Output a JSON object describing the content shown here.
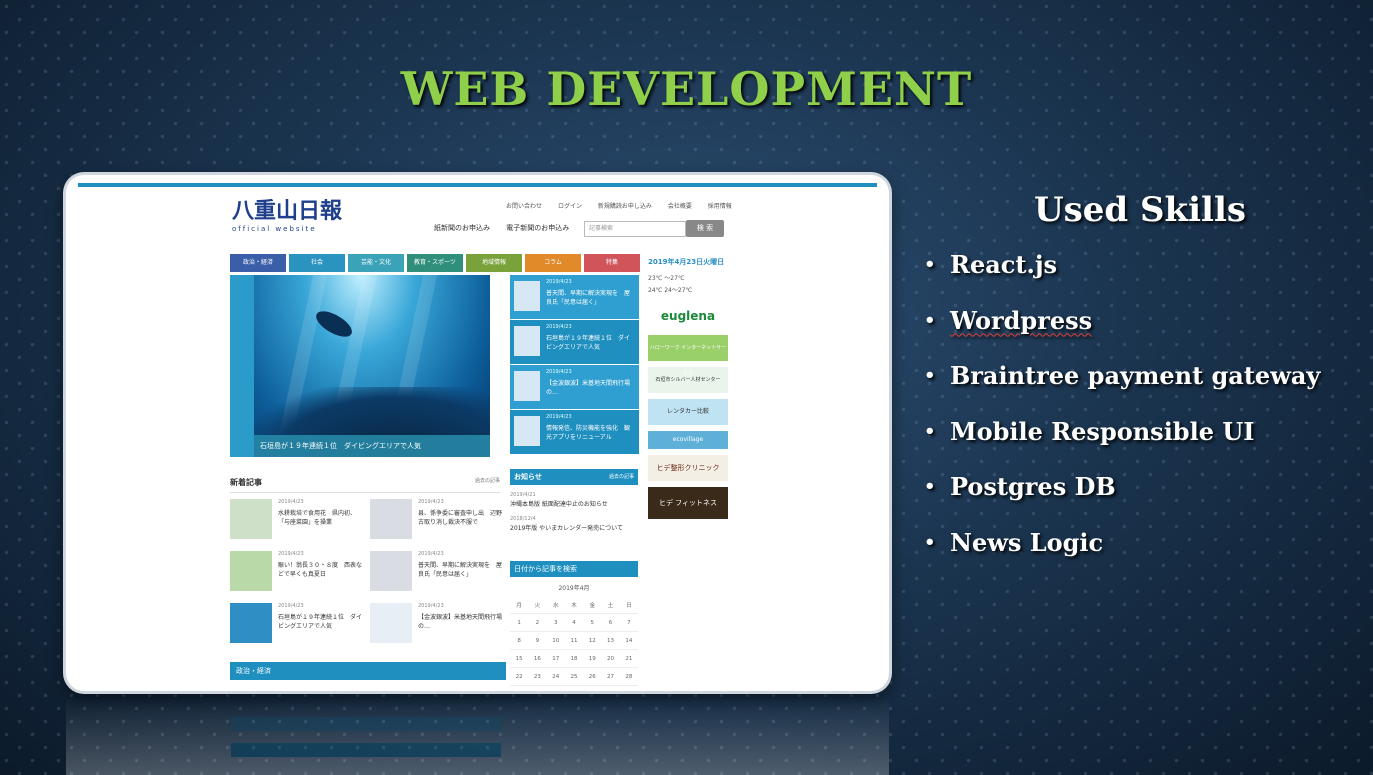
{
  "slide": {
    "title": "WEB DEVELOPMENT",
    "colors": {
      "title": "#8fcf4a",
      "background": "#1b3550",
      "text": "#ffffff"
    }
  },
  "skills": {
    "heading": "Used Skills",
    "items": [
      {
        "label": "React.js"
      },
      {
        "label": "Wordpress"
      },
      {
        "label": "Braintree payment gateway"
      },
      {
        "label": "Mobile Responsible UI"
      },
      {
        "label": "Postgres DB"
      },
      {
        "label": "News Logic"
      }
    ]
  },
  "site": {
    "logo": "八重山日報",
    "logo_sub": "official website",
    "top_links": [
      "お問い合わせ",
      "ログイン",
      "新規購読お申し込み",
      "会社概要",
      "採用情報"
    ],
    "subscribe": [
      "紙新聞のお申込み",
      "電子新聞のお申込み"
    ],
    "search_placeholder": "記事検索",
    "search_button": "検 索",
    "nav": [
      {
        "label": "政治・経済",
        "color": "#3b5ea8"
      },
      {
        "label": "社会",
        "color": "#2a93c0"
      },
      {
        "label": "芸能・文化",
        "color": "#3aa3b8"
      },
      {
        "label": "教育・スポーツ",
        "color": "#2f8f7a"
      },
      {
        "label": "地域情報",
        "color": "#7aa23a"
      },
      {
        "label": "コラム",
        "color": "#e08a2a"
      },
      {
        "label": "特集",
        "color": "#d0545a"
      }
    ],
    "hero_caption": "石垣島が１９年連続１位　ダイビングエリアで人気",
    "featured": [
      {
        "date": "2019/4/23",
        "title": "普天間、早期に解決実現を　屋良氏「民意は届く」"
      },
      {
        "date": "2019/4/23",
        "title": "石垣島が１９年連続１位　ダイビングエリアで人気"
      },
      {
        "date": "2019/4/23",
        "title": "【金波銀波】米基地天間飛行場の…"
      },
      {
        "date": "2019/4/23",
        "title": "情報発信、防災機能を強化　観光アプリをリニューアル"
      }
    ],
    "sidebar_date": "2019年4月23日火曜日",
    "weather": [
      "23℃  ～27℃",
      "24℃  24～27℃"
    ],
    "ads": [
      "euglena",
      "ハローワーク インターネットサービス",
      "石垣市シルバー人材センター",
      "レンタカー比較",
      "ecovillage",
      "ヒデ整形クリニック",
      "ヒデ フィットネス"
    ],
    "news_heading": "新着記事",
    "news_more": "過去の記事",
    "news": [
      {
        "date": "2019/4/23",
        "title": "水耕栽培で食用花　県内初、「与座菜園」を操業"
      },
      {
        "date": "2019/4/23",
        "title": "县、係争委に審査申し出　辺野古取り消し裁決不服で"
      },
      {
        "date": "2019/4/23",
        "title": "賑い！翁長３０・８度　西表などで早くも真夏日"
      },
      {
        "date": "2019/4/23",
        "title": "普天間、早期に解決実現を　屋良氏「民意は届く」"
      },
      {
        "date": "2019/4/23",
        "title": "石垣島が１９年連続１位　ダイビングエリアで人気"
      },
      {
        "date": "2019/4/23",
        "title": "【金波銀波】米基地天間飛行場の…"
      }
    ],
    "oshirase_heading": "お知らせ",
    "oshirase_more": "過去の記事",
    "oshirase": [
      {
        "date": "2019/4/21",
        "title": "沖縄本島版 紙面配達中止のお知らせ"
      },
      {
        "date": "2018/12/4",
        "title": "2019年版 やいまカレンダー発売について"
      }
    ],
    "calendar_heading": "日付から記事を検索",
    "calendar_month": "2019年4月",
    "calendar_days": [
      "月",
      "火",
      "水",
      "木",
      "金",
      "土",
      "日"
    ],
    "calendar_rows": [
      [
        "1",
        "2",
        "3",
        "4",
        "5",
        "6",
        "7"
      ],
      [
        "8",
        "9",
        "10",
        "11",
        "12",
        "13",
        "14"
      ],
      [
        "15",
        "16",
        "17",
        "18",
        "19",
        "20",
        "21"
      ],
      [
        "22",
        "23",
        "24",
        "25",
        "26",
        "27",
        "28"
      ]
    ],
    "section_heading": "政治・経済"
  }
}
